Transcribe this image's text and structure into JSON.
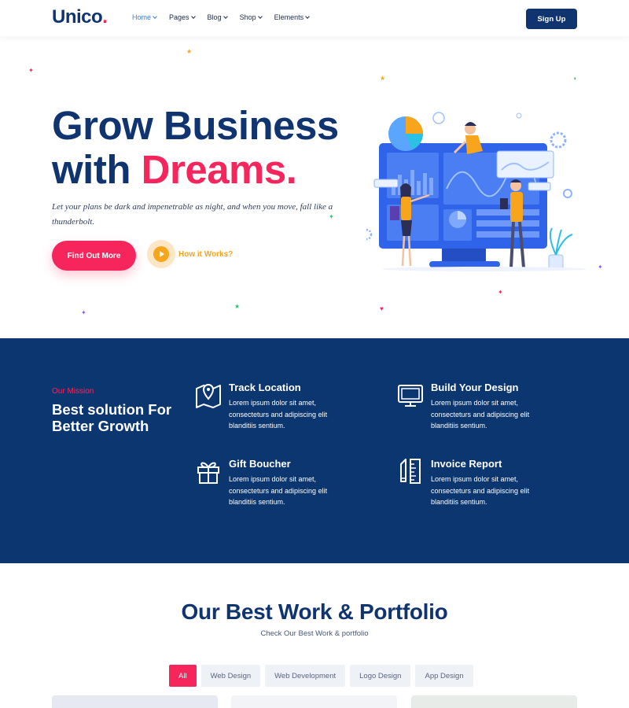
{
  "nav": {
    "logo_text": "Unico",
    "logo_dot": ".",
    "menu": [
      {
        "label": "Home",
        "active": true
      },
      {
        "label": "Pages"
      },
      {
        "label": "Blog"
      },
      {
        "label": "Shop"
      },
      {
        "label": "Elements"
      }
    ],
    "signup_label": "Sign Up"
  },
  "hero": {
    "title_line1": "Grow Business",
    "title_line2_prefix": "with ",
    "title_line2_highlight": "Dreams.",
    "description": "Let your plans be dark and impenetrable as night, and when you move, fall like a thunderbolt.",
    "primary_button": "Find Out More",
    "secondary_link": "How it Works?"
  },
  "mission": {
    "label": "Our Mission",
    "heading": "Best solution For Better Growth",
    "features": [
      {
        "title": "Track Location",
        "icon": "map-pin-icon",
        "description": "Lorem ipsum dolor sit amet, consecteturs and adipiscing elit blanditiis sentium."
      },
      {
        "title": "Build Your Design",
        "icon": "monitor-icon",
        "description": "Lorem ipsum dolor sit amet, consecteturs and adipiscing elit blanditiis sentium."
      },
      {
        "title": "Gift Boucher",
        "icon": "gift-icon",
        "description": "Lorem ipsum dolor sit amet, consecteturs and adipiscing elit blanditiis sentium."
      },
      {
        "title": "Invoice Report",
        "icon": "pencil-ruler-icon",
        "description": "Lorem ipsum dolor sit amet, consecteturs and adipiscing elit blanditiis sentium."
      }
    ]
  },
  "portfolio": {
    "title": "Our Best Work & Portfolio",
    "subtitle": "Check Our Best Work & portfolio",
    "filters": [
      "All",
      "Web Design",
      "Web Development",
      "Logo Design",
      "App Design"
    ],
    "active_filter": "All"
  },
  "colors": {
    "navy": "#0f3470",
    "mission_bg": "#0c366f",
    "accent_pink": "#f6255c",
    "accent_orange": "#f7a51c",
    "link_blue": "#3a7be0"
  }
}
